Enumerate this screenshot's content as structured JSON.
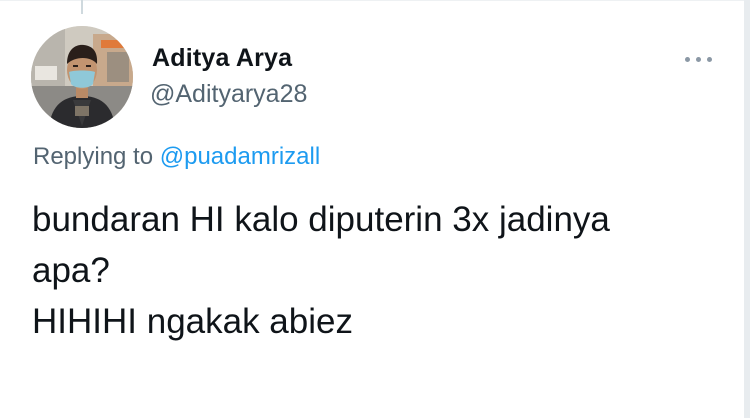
{
  "tweet": {
    "author": {
      "name": "Aditya Arya",
      "handle": "@Adityarya28",
      "avatar_icon": "profile-photo"
    },
    "more_icon": "more-horizontal-icon",
    "reply": {
      "prefix": "Replying to",
      "to_handle": "@puadamrizall"
    },
    "text_lines": [
      "bundaran HI kalo diputerin 3x jadinya",
      "apa?",
      "HIHIHI ngakak abiez"
    ]
  },
  "colors": {
    "text": "#0f1419",
    "secondary": "#536471",
    "link": "#1d9bf0"
  }
}
